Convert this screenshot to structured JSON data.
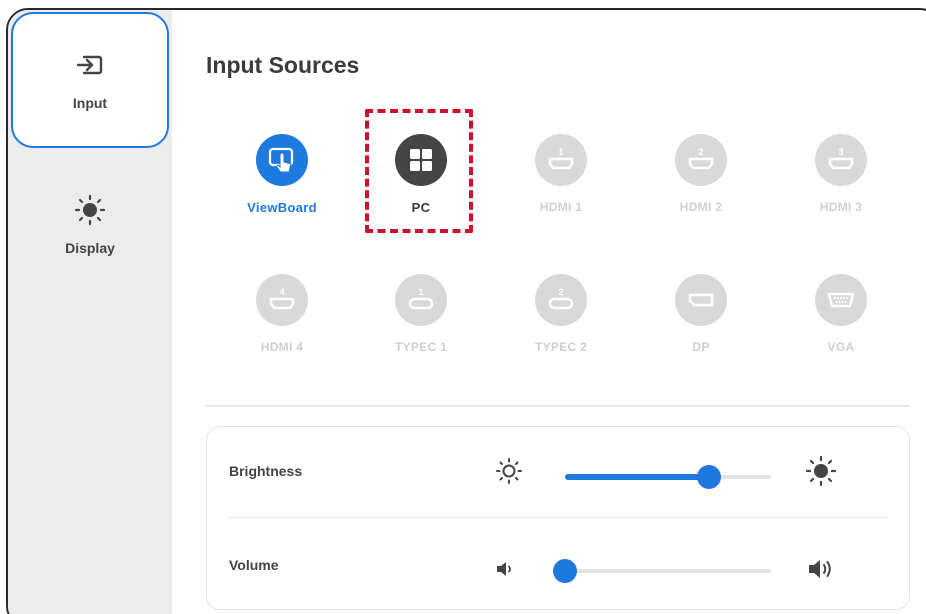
{
  "sidebar": {
    "items": [
      {
        "label": "Input",
        "icon": "input-icon",
        "active": true
      },
      {
        "label": "Display",
        "icon": "brightness-icon",
        "active": false
      }
    ]
  },
  "main": {
    "title": "Input Sources",
    "sources": [
      {
        "label": "ViewBoard",
        "icon": "viewboard-icon",
        "state": "selected"
      },
      {
        "label": "PC",
        "icon": "windows-icon",
        "state": "highlighted"
      },
      {
        "label": "HDMI 1",
        "icon": "hdmi-icon",
        "number": "1",
        "state": "disabled"
      },
      {
        "label": "HDMI 2",
        "icon": "hdmi-icon",
        "number": "2",
        "state": "disabled"
      },
      {
        "label": "HDMI 3",
        "icon": "hdmi-icon",
        "number": "3",
        "state": "disabled"
      },
      {
        "label": "HDMI 4",
        "icon": "hdmi-icon",
        "number": "4",
        "state": "disabled"
      },
      {
        "label": "TYPEC 1",
        "icon": "usb-c-icon",
        "number": "1",
        "state": "disabled"
      },
      {
        "label": "TYPEC 2",
        "icon": "usb-c-icon",
        "number": "2",
        "state": "disabled"
      },
      {
        "label": "DP",
        "icon": "displayport-icon",
        "state": "disabled"
      },
      {
        "label": "VGA",
        "icon": "vga-icon",
        "state": "disabled"
      }
    ]
  },
  "controls": {
    "brightness": {
      "label": "Brightness",
      "value_fraction": 0.7
    },
    "volume": {
      "label": "Volume",
      "value_fraction": 0.0
    }
  },
  "colors": {
    "accent": "#1f7ae0",
    "highlight": "#d0112b",
    "disabled": "#d9d9d9",
    "pc": "#454545"
  }
}
